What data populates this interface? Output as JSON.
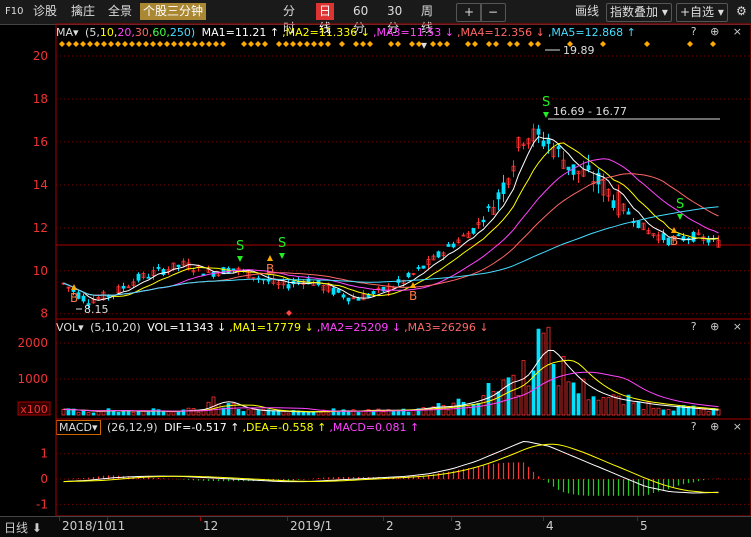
{
  "toolbar": {
    "code_label": "F10",
    "diagnose": "诊股",
    "select": "擒庄",
    "fullview": "全景",
    "indicator_tab": "个股三分钟",
    "period_tabs": [
      "分时",
      "日线",
      "60分",
      "30分",
      "周线"
    ],
    "active_period": "日线",
    "draw": "画线",
    "overlay": "指数叠加",
    "watchlist": "+自选"
  },
  "main_panel": {
    "indicator": "MA▾",
    "params_prefix": "(5,",
    "params": [
      "10,",
      "20,",
      "30,",
      "60,",
      "250)"
    ],
    "items": [
      {
        "text": "MA1=11.21",
        "arrow": "↑",
        "color": "#ffffff"
      },
      {
        "text": "MA2=11.336",
        "arrow": "↓",
        "color": "#ffff00"
      },
      {
        "text": "MA3=11.53",
        "arrow": "↓",
        "color": "#ff44ff"
      },
      {
        "text": "MA4=12.356",
        "arrow": "↓",
        "color": "#ff6666"
      },
      {
        "text": "MA5=12.868",
        "arrow": "↑",
        "color": "#44ddff"
      }
    ],
    "y_ticks": [
      "20",
      "18",
      "16",
      "14",
      "12",
      "10",
      "8"
    ],
    "ylim": [
      7.8,
      20.7
    ],
    "annotations": {
      "high": "19.89",
      "low": "8.15",
      "range": "16.69 - 16.77"
    }
  },
  "vol_panel": {
    "indicator": "VOL▾",
    "params": "(5,10,20)",
    "items": [
      {
        "text": "VOL=11343",
        "arrow": "↓",
        "color": "#ffffff"
      },
      {
        "text": "MA1=17779",
        "arrow": "↓",
        "color": "#ffff00"
      },
      {
        "text": "MA2=25209",
        "arrow": "↓",
        "color": "#ff44ff"
      },
      {
        "text": "MA3=26296",
        "arrow": "↓",
        "color": "#ff6666"
      }
    ],
    "y_ticks": [
      "2000",
      "1000",
      "x100"
    ]
  },
  "macd_panel": {
    "indicator": "MACD▾",
    "params": "(26,12,9)",
    "items": [
      {
        "text": "DIF=-0.517",
        "arrow": "↑",
        "color": "#ffffff"
      },
      {
        "text": "DEA=-0.558",
        "arrow": "↑",
        "color": "#ffff00"
      },
      {
        "text": "MACD=0.081",
        "arrow": "↑",
        "color": "#ff44ff"
      }
    ],
    "y_ticks": [
      "1",
      "0",
      "-1"
    ]
  },
  "panel_controls": "? ⊕ ×",
  "bottom": {
    "period_label": "日线",
    "dates": [
      "2018/10",
      "11",
      "12",
      "2019/1",
      "2",
      "3",
      "4",
      "5"
    ]
  },
  "signals": {
    "buy": "B",
    "sell": "S"
  },
  "colors": {
    "up": "#ff3232",
    "down": "#00e0ff",
    "grid": "#7a0000",
    "axis": "#aa0000"
  },
  "chart_data": [
    {
      "type": "line",
      "ylim": [
        7.8,
        20.7
      ],
      "annotations": [
        "19.89",
        "8.15",
        "16.69 - 16.77"
      ],
      "series": [
        {
          "name": "MA1",
          "color": "#ffffff"
        },
        {
          "name": "MA2",
          "color": "#ffff00"
        },
        {
          "name": "MA3",
          "color": "#ff44ff"
        },
        {
          "name": "MA4",
          "color": "#ff6666"
        },
        {
          "name": "MA5",
          "color": "#44ddff"
        }
      ],
      "x": [
        "2018/10",
        "11",
        "12",
        "2019/1",
        "2",
        "3",
        "4",
        "5"
      ],
      "close": [
        9.4,
        8.6,
        8.9,
        9.6,
        10.0,
        10.3,
        9.9,
        10.1,
        9.7,
        9.3,
        9.6,
        9.1,
        8.7,
        9.0,
        9.5,
        10.3,
        11.2,
        12.0,
        13.6,
        16.4,
        16.0,
        14.7,
        14.2,
        13.0,
        11.9,
        11.4,
        11.6,
        11.3
      ]
    },
    {
      "type": "bar",
      "ylim": [
        0,
        2200
      ],
      "values": [
        160,
        120,
        90,
        140,
        110,
        100,
        120,
        80,
        150,
        130,
        480,
        260,
        130,
        120,
        100,
        90,
        80,
        110,
        120,
        100,
        150,
        120,
        140,
        160,
        240,
        220,
        320,
        420,
        620,
        1050,
        900,
        2100,
        1600,
        1100,
        750,
        560,
        420,
        380,
        300,
        260,
        220,
        180,
        150,
        110
      ]
    },
    {
      "type": "bar",
      "ylim": [
        -1.3,
        1.7
      ],
      "series": [
        {
          "name": "DIF",
          "color": "#ffffff"
        },
        {
          "name": "DEA",
          "color": "#ffff00"
        },
        {
          "name": "MACD",
          "color": "#ff44ff"
        }
      ],
      "dif": [
        -0.1,
        -0.05,
        0.05,
        0.1,
        0.12,
        0.1,
        0.05,
        0.0,
        -0.05,
        -0.1,
        -0.1,
        -0.05,
        0.0,
        0.05,
        0.1,
        0.2,
        0.4,
        0.7,
        1.1,
        1.5,
        1.3,
        0.9,
        0.5,
        0.1,
        -0.3,
        -0.5,
        -0.55,
        -0.52
      ]
    }
  ]
}
